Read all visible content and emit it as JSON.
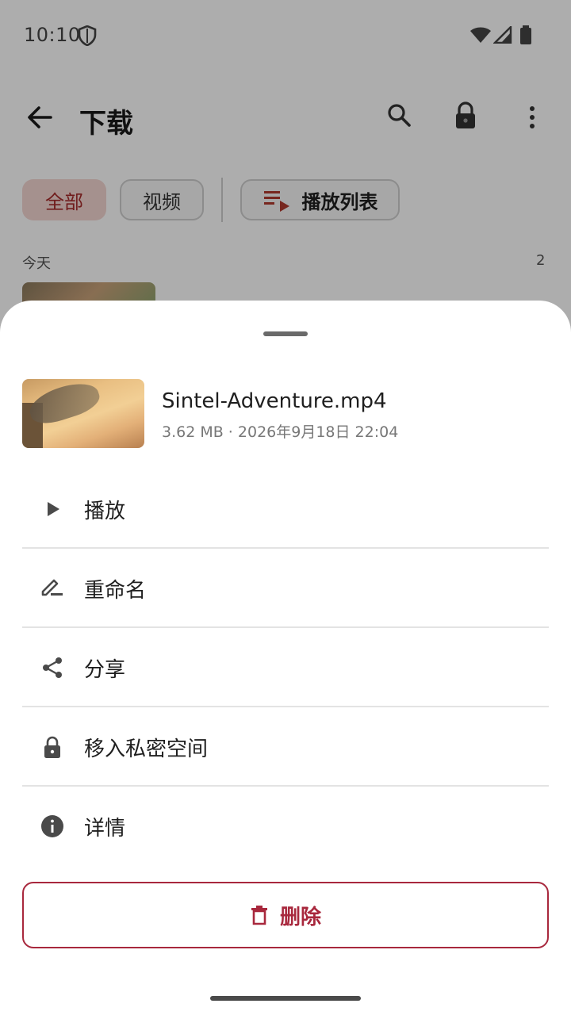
{
  "status_bar": {
    "time": "10:10"
  },
  "header": {
    "title": "下载"
  },
  "filters": {
    "all": "全部",
    "video": "视频",
    "playlist": "播放列表"
  },
  "section": {
    "label": "今天",
    "count": "2"
  },
  "sheet": {
    "file": {
      "name": "Sintel-Adventure.mp4",
      "meta": "3.62 MB · 2026年9月18日 22:04"
    },
    "menu": [
      {
        "icon": "play-icon",
        "label": "播放"
      },
      {
        "icon": "rename-icon",
        "label": "重命名"
      },
      {
        "icon": "share-icon",
        "label": "分享"
      },
      {
        "icon": "lock-icon",
        "label": "移入私密空间"
      },
      {
        "icon": "info-icon",
        "label": "详情"
      }
    ],
    "delete_label": "删除"
  },
  "colors": {
    "accent": "#a8283d",
    "chip_selected_bg": "#f3d6d2"
  }
}
